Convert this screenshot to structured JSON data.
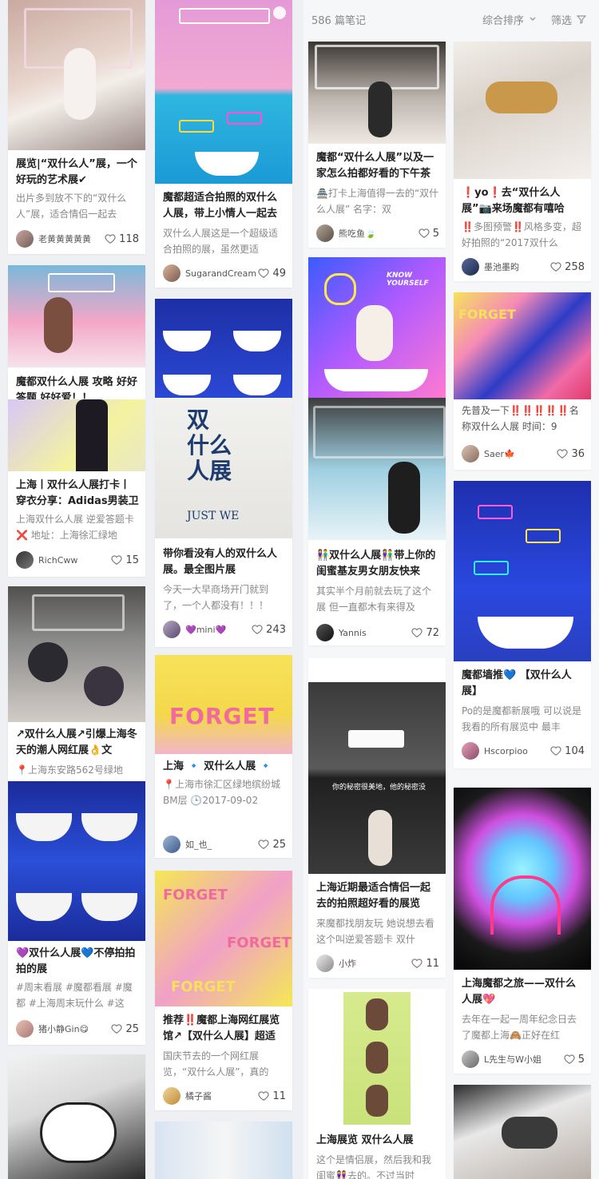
{
  "header": {
    "note_count": "586 篇笔记",
    "sort_label": "综合排序",
    "filter_label": "筛选"
  },
  "colors": {
    "heart": "#777777",
    "title": "#222222",
    "desc": "#888888",
    "accent_pink": "#ff2d8a",
    "accent_blue": "#2a5cff"
  },
  "icons": {
    "like": "heart-icon",
    "sort": "chevron-down-icon",
    "filter": "funnel-icon"
  },
  "notes": {
    "n1": {
      "title": "展览|“双什么人”展，一个好玩的艺术展✔",
      "desc": "出片多到放不下的“双什么人”展，适合情侣一起去",
      "author": "老黄黄黄黄黄",
      "likes": "118"
    },
    "n2": {
      "title": "魔都双什么人展 攻略 好好答题 好好爱！！",
      "desc": "",
      "author": "",
      "likes": ""
    },
    "n3": {
      "title": "上海丨双什么人展打卡丨穿衣分享：Adidas男装卫",
      "desc": "上海双什么人展 逆爱答题卡❌ 地址：上海徐汇绿地",
      "author": "RichCww",
      "likes": "15"
    },
    "n4": {
      "title": "↗双什么人展↗引爆上海冬天的潮人网红展👌文",
      "desc": "📍上海东安路562号绿地",
      "author": "",
      "likes": ""
    },
    "n5": {
      "title": "💜双什么人展💙不停拍拍拍的展",
      "desc": "#周末看展 #魔都看展 #魔都 #上海周末玩什么 #这",
      "author": "猪小静Gin😋",
      "likes": "25"
    },
    "n6": {
      "title": "魔都超适合拍照的双什么人展，带上小情人一起去",
      "desc": "双什么人展这是一个超级适合拍照的展，虽然更适",
      "author": "SugarandCream",
      "likes": "49"
    },
    "n7": {
      "title": "带你看没有人的双什么人展。最全图片展",
      "desc": "今天一大早商场开门就到了，一个人都没有！！！",
      "author": "💜mini💜",
      "likes": "243"
    },
    "n8": {
      "title": "上海 🔹 双什么人展 🔹",
      "desc": "📍上海市徐汇区绿地缤纷城BM层 🕒2017-09-02",
      "author": "如_也_",
      "likes": "25"
    },
    "n9": {
      "title": "推荐‼️魔都上海网红展览馆↗【双什么人展】超适",
      "desc": "国庆节去的一个网红展览，“双什么人展”，真的",
      "author": "橘子酱",
      "likes": "11"
    },
    "n10": {
      "title": "魔都“双什么人展”以及一家怎么拍都好看的下午茶",
      "desc": "🏯打卡上海值得一去的“双什么人展” 名字：双",
      "author": "熊吃鱼🍃",
      "likes": "5"
    },
    "n11": {
      "title": "👫双什么人展👫带上你的闺蜜基友男女朋友快来",
      "desc": "其实半个月前就去玩了这个展 但一直都木有来得及",
      "author": "Yannis",
      "likes": "72"
    },
    "n12": {
      "title": "上海近期最适合情侣一起去的拍照超好看的展览",
      "desc": "来魔都找朋友玩 她说想去看这个叫逆爱答题卡 双什",
      "author": "小炸",
      "likes": "11"
    },
    "n13": {
      "title": "上海展览 双什么人展",
      "desc": "这个是情侣展，然后我和我闺蜜👭去的。不过当时",
      "author": "",
      "likes": ""
    },
    "n14": {
      "title": "❗yo❗去“双什么人展”📷来场魔都有嘻哈",
      "desc": "‼️多图预警‼️风格多变，超好拍照的“2017双什么",
      "author": "墨池墨昀",
      "likes": "258"
    },
    "n15": {
      "title": "",
      "desc": "先普及一下‼️‼️‼️‼️‼️名称双什么人展 时间：9",
      "author": "Saer🍁",
      "likes": "36"
    },
    "n16": {
      "title": "魔都墙推💙 【双什么人展】",
      "desc": "Po的是魔都新展哦 可以说是我看的所有展览中 最丰",
      "author": "Hscorpioo",
      "likes": "104"
    },
    "n17": {
      "title": "上海魔都之旅——双什么人展💖",
      "desc": "去年在一起一周年纪念日去了魔都上海🙈正好在红",
      "author": "L先生与W小姐",
      "likes": "5"
    }
  },
  "artwork": {
    "sign_line1": "双",
    "sign_line2": "什么",
    "sign_line3": "人展",
    "sign_sub": "JUST WE",
    "forget_text": "FORGET",
    "know_yourself": "KNOW YOURSELF",
    "wall_text": "你的秘密很美地，他的秘密没"
  }
}
